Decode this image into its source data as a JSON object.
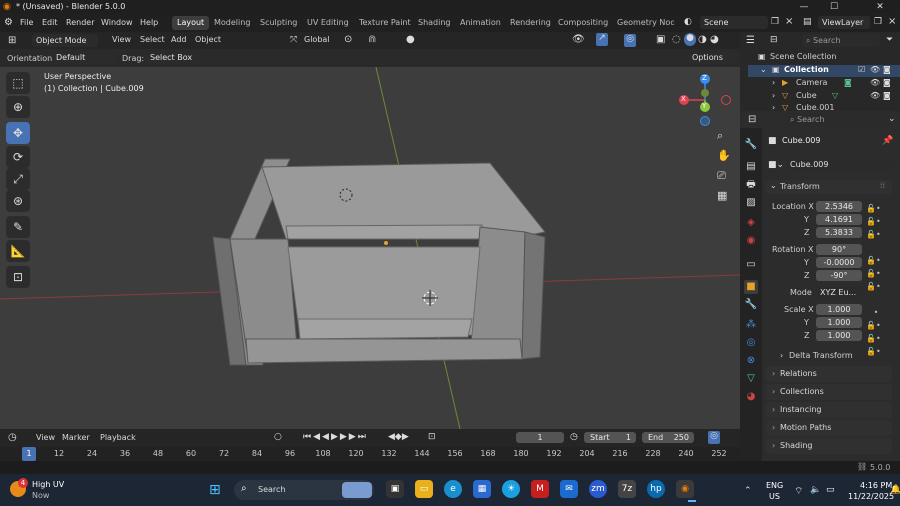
{
  "window": {
    "title": "* (Unsaved) - Blender 5.0.0",
    "min": "—",
    "max": "☐",
    "close": "✕"
  },
  "menu": {
    "blender_icon": "blender-logo-icon",
    "items": [
      "File",
      "Edit",
      "Render",
      "Window",
      "Help"
    ]
  },
  "workspaces": [
    "Layout",
    "Modeling",
    "Sculpting",
    "UV Editing",
    "Texture Paint",
    "Shading",
    "Animation",
    "Rendering",
    "Compositing",
    "Geometry Node"
  ],
  "scene": {
    "name": "Scene",
    "view_layer": "ViewLayer"
  },
  "viewport_header": {
    "mode": "Object Mode",
    "view": "View",
    "select": "Select",
    "add": "Add",
    "object": "Object",
    "transform": "Global",
    "search_placeholder": "Search"
  },
  "tool_settings": {
    "orientation_label": "Orientation:",
    "orientation": "Default",
    "drag_label": "Drag:",
    "drag": "Select Box",
    "options": "Options"
  },
  "viewport": {
    "perspective": "User Perspective",
    "collection_info": "(1) Collection | Cube.009",
    "gizmo": {
      "z": "Z",
      "y": "Y",
      "x": "X"
    }
  },
  "outliner": {
    "search_placeholder": "Search",
    "root": "Scene Collection",
    "collection": "Collection",
    "items": [
      "Camera",
      "Cube",
      "Cube.001"
    ]
  },
  "properties": {
    "search_placeholder": "Search",
    "object_name": "Cube.009",
    "data_name": "Cube.009",
    "transform_label": "Transform",
    "location": {
      "label": "Location X",
      "x": "2.5346",
      "y_label": "Y",
      "y": "4.1691",
      "z_label": "Z",
      "z": "5.3833"
    },
    "rotation": {
      "label": "Rotation X",
      "x": "90°",
      "y_label": "Y",
      "y": "-0.0000",
      "z_label": "Z",
      "z": "-90°"
    },
    "mode_label": "Mode",
    "mode": "XYZ Eu...",
    "scale": {
      "label": "Scale X",
      "x": "1.000",
      "y_label": "Y",
      "y": "1.000",
      "z_label": "Z",
      "z": "1.000"
    },
    "delta": "Delta Transform",
    "panels": [
      "Relations",
      "Collections",
      "Instancing",
      "Motion Paths",
      "Shading"
    ]
  },
  "timeline": {
    "view": "View",
    "marker": "Marker",
    "playback": "Playback",
    "current_frame": "1",
    "start_label": "Start",
    "start": "1",
    "end_label": "End",
    "end": "250",
    "ticks": [
      "1",
      "12",
      "24",
      "36",
      "48",
      "60",
      "72",
      "84",
      "96",
      "108",
      "120",
      "132",
      "144",
      "156",
      "168",
      "180",
      "192",
      "204",
      "216",
      "228",
      "240",
      "252"
    ]
  },
  "status": {
    "version": "5.0.0"
  },
  "taskbar": {
    "weather_title": "High UV",
    "weather_sub": "Now",
    "weather_badge": "4",
    "search": "Search",
    "lang1": "ENG",
    "lang2": "US",
    "time": "4:16 PM",
    "date": "11/22/2025"
  },
  "colors": {
    "accent": "#4772b3",
    "x_axis": "#e0414f",
    "y_axis": "#8bc83f",
    "z_axis": "#3a8df0",
    "viewport_bg": "#3d3d3d"
  }
}
